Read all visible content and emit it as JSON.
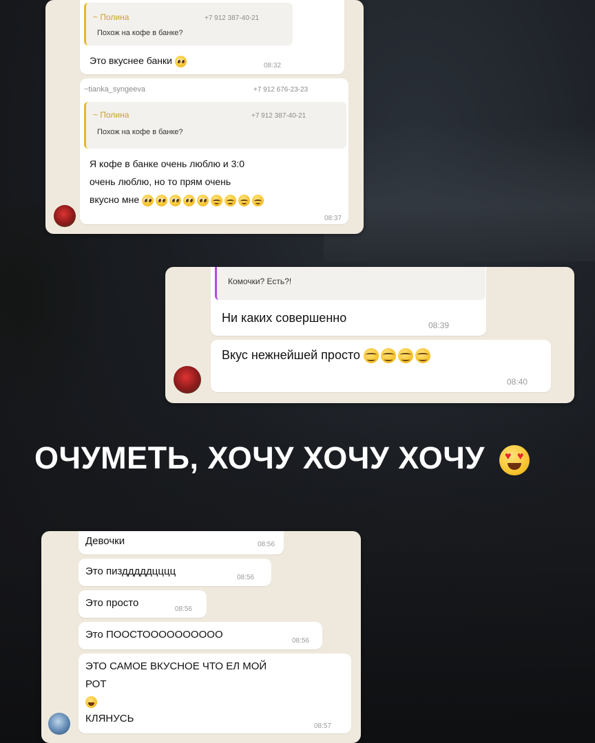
{
  "screen1": {
    "msg1": {
      "quote_name": "~ Полина",
      "quote_phone": "+7 912 387-40-21",
      "quote_text": "Похож на кофе в банке?",
      "text": "Это вкуснее банки",
      "time": "08:32"
    },
    "msg2": {
      "sender": "~tianka_syngeeva",
      "sender_phone": "+7 912 676-23-23",
      "quote_name": "~ Полина",
      "quote_phone": "+7 912 387-40-21",
      "quote_text": "Похож на кофе в банке?",
      "line1": "Я кофе в банке очень люблю и 3:0",
      "line2": "очень люблю, но то прям очень",
      "line3": "вкусно мне",
      "time": "08:37"
    }
  },
  "screen2": {
    "quote_text": "Комочки? Есть?!",
    "msg1": {
      "text": "Ни каких совершенно",
      "time": "08:39"
    },
    "msg2": {
      "text": "Вкус нежнейшей просто",
      "time": "08:40"
    }
  },
  "headline": "ОЧУМЕТЬ, ХОЧУ ХОЧУ ХОЧУ",
  "screen3": {
    "msgs": [
      {
        "text": "Девочки",
        "time": "08:56"
      },
      {
        "text": "Это пиздддддцццц",
        "time": "08:56"
      },
      {
        "text": "Это просто",
        "time": "08:56"
      },
      {
        "text": "Это ПООСТОООООООООО",
        "time": "08:56"
      }
    ],
    "last": {
      "line1": "ЭТО САМОЕ ВКУСНОЕ ЧТО ЕЛ МОЙ",
      "line2": "РОТ",
      "line3": "КЛЯНУСЬ",
      "time": "08:57"
    }
  },
  "icons": [
    "pleading-face-emoji",
    "relieved-face-emoji",
    "face-with-tears-of-joy-emoji",
    "heart-eyes-emoji",
    "avatar"
  ]
}
